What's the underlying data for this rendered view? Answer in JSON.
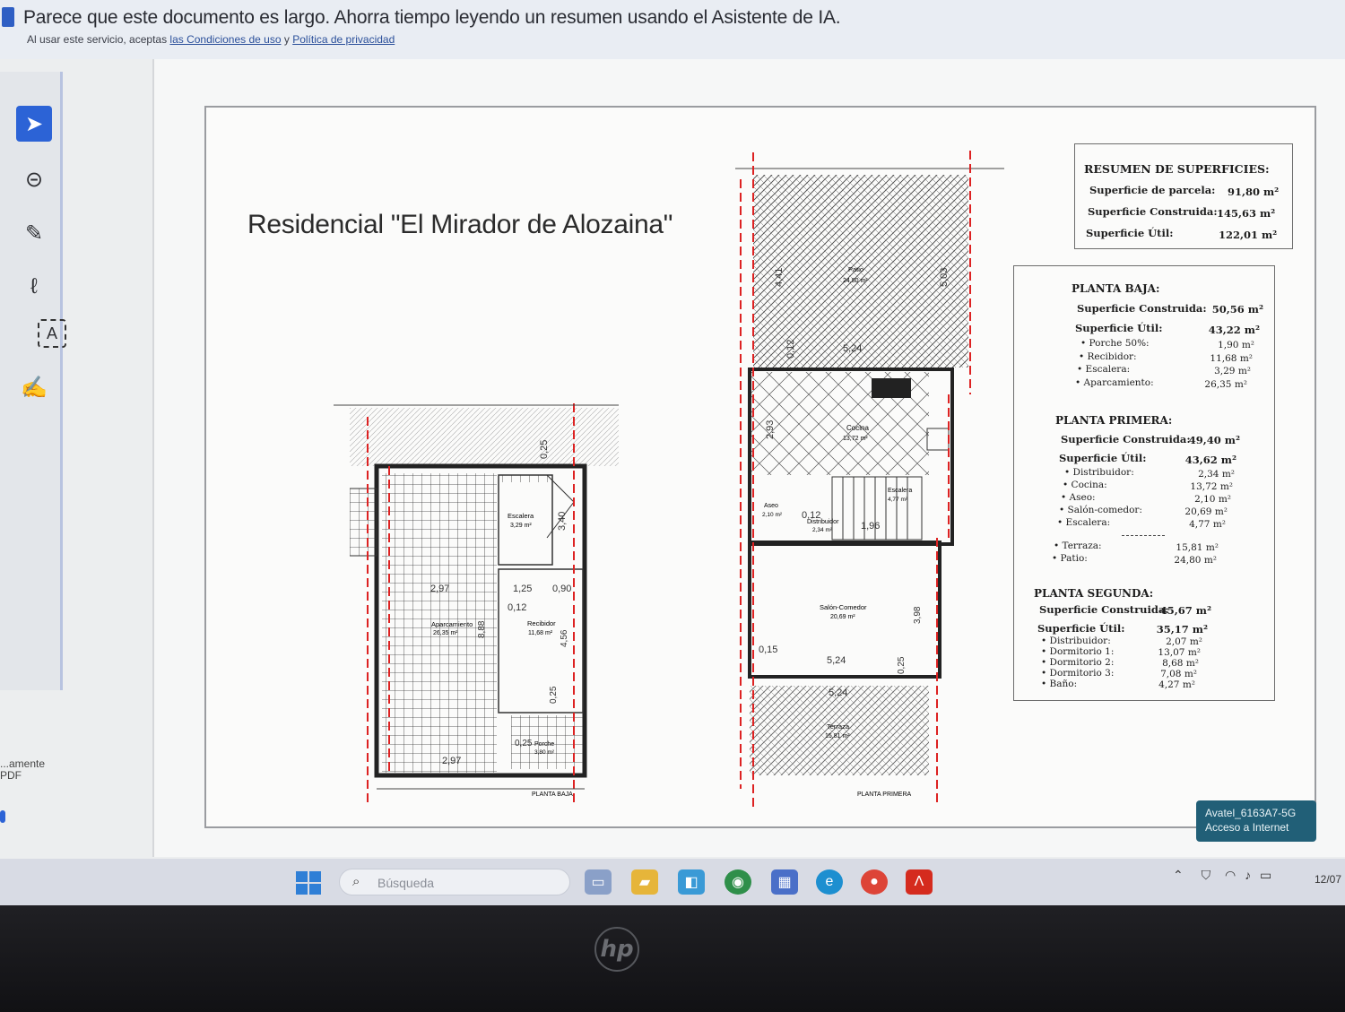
{
  "ai_banner": {
    "message": "Parece que este documento es largo. Ahorra tiempo leyendo un resumen usando el Asistente de IA.",
    "terms_prefix": "Al usar este servicio, aceptas",
    "terms_link": "las Condiciones de uso",
    "terms_joiner": "y",
    "privacy_link": "Política de privacidad"
  },
  "tools": [
    {
      "name": "select-tool-icon",
      "glyph": "➤"
    },
    {
      "name": "comment-tool-icon",
      "glyph": "⊝"
    },
    {
      "name": "highlight-tool-icon",
      "glyph": "✎"
    },
    {
      "name": "draw-tool-icon",
      "glyph": "ℓ"
    },
    {
      "name": "text-tool-icon",
      "glyph": "A"
    },
    {
      "name": "sign-tool-icon",
      "glyph": "✍"
    }
  ],
  "rail_label": "...amente\nPDF",
  "document": {
    "title": "Residencial \"El Mirador de Alozaina\"",
    "resumen": {
      "header": "RESUMEN DE SUPERFICIES:",
      "rows": [
        {
          "label": "Superficie de parcela:",
          "value": "91,80 m²"
        },
        {
          "label": "Superficie Construida:",
          "value": "145,63 m²"
        },
        {
          "label": "Superficie Útil:",
          "value": "122,01 m²"
        }
      ]
    },
    "planta_baja": {
      "header": "PLANTA BAJA:",
      "construida_label": "Superficie Construida:",
      "construida_value": "50,56 m²",
      "util_label": "Superficie Útil:",
      "util_value": "43,22 m²",
      "items": [
        {
          "label": "• Porche 50%:",
          "value": "1,90 m²"
        },
        {
          "label": "• Recibidor:",
          "value": "11,68 m²"
        },
        {
          "label": "• Escalera:",
          "value": "3,29 m²"
        },
        {
          "label": "• Aparcamiento:",
          "value": "26,35 m²"
        }
      ]
    },
    "planta_primera": {
      "header": "PLANTA PRIMERA:",
      "construida_label": "Superficie Construida:",
      "construida_value": "49,40 m²",
      "util_label": "Superficie Útil:",
      "util_value": "43,62 m²",
      "items": [
        {
          "label": "• Distribuidor:",
          "value": "2,34 m²"
        },
        {
          "label": "• Cocina:",
          "value": "13,72 m²"
        },
        {
          "label": "• Aseo:",
          "value": "2,10 m²"
        },
        {
          "label": "• Salón-comedor:",
          "value": "20,69 m²"
        },
        {
          "label": "• Escalera:",
          "value": "4,77 m²"
        }
      ],
      "extra": [
        {
          "label": "• Terraza:",
          "value": "15,81 m²"
        },
        {
          "label": "• Patio:",
          "value": "24,80 m²"
        }
      ]
    },
    "planta_segunda": {
      "header": "PLANTA SEGUNDA:",
      "construida_label": "Superficie Construida:",
      "construida_value": "45,67 m²",
      "util_label": "Superficie Útil:",
      "util_value": "35,17 m²",
      "items": [
        {
          "label": "• Distribuidor:",
          "value": "2,07 m²"
        },
        {
          "label": "• Dormitorio 1:",
          "value": "13,07 m²"
        },
        {
          "label": "• Dormitorio 2:",
          "value": "8,68 m²"
        },
        {
          "label": "• Dormitorio 3:",
          "value": "7,08 m²"
        },
        {
          "label": "• Baño:",
          "value": "4,27 m²"
        }
      ]
    },
    "plan_baja": {
      "caption": "PLANTA BAJA",
      "aparcamiento": "Aparcamiento",
      "aparcamiento_area": "26,35 m²",
      "escalera": "Escalera",
      "escalera_area": "3,29 m²",
      "recibidor": "Recibidor",
      "recibidor_area": "11,68 m²",
      "porche": "Porche",
      "porche_area": "3,80 m²",
      "dims": [
        "0,25",
        "3,40",
        "2,97",
        "1,25",
        "0,90",
        "0,12",
        "8,88",
        "4,56",
        "0,25",
        "0,25",
        "2,97"
      ]
    },
    "plan_primera": {
      "caption": "PLANTA PRIMERA",
      "patio": "Patio",
      "patio_area": "24,80 m²",
      "cocina": "Cocina",
      "cocina_area": "13,72 m²",
      "aseo": "Aseo",
      "aseo_area": "2,10 m²",
      "distribuidor": "Distribuidor",
      "distribuidor_area": "2,34 m²",
      "escalera": "Escalera",
      "escalera_area": "4,77 m²",
      "salon": "Salón-Comedor",
      "salon_area": "20,69 m²",
      "terraza": "Terraza",
      "terraza_area": "15,81 m²",
      "dims": [
        "4,41",
        "5,03",
        "5,24",
        "0,12",
        "2,93",
        "0,12",
        "1,96",
        "3,98",
        "5,24",
        "0,25",
        "0,15",
        "5,24"
      ]
    }
  },
  "wifi_toast": {
    "line1": "Avatel_6163A7-5G",
    "line2": "Acceso a Internet"
  },
  "taskbar": {
    "search_placeholder": "Búsqueda",
    "clock": "12/07"
  },
  "bezel_logo": "hp"
}
